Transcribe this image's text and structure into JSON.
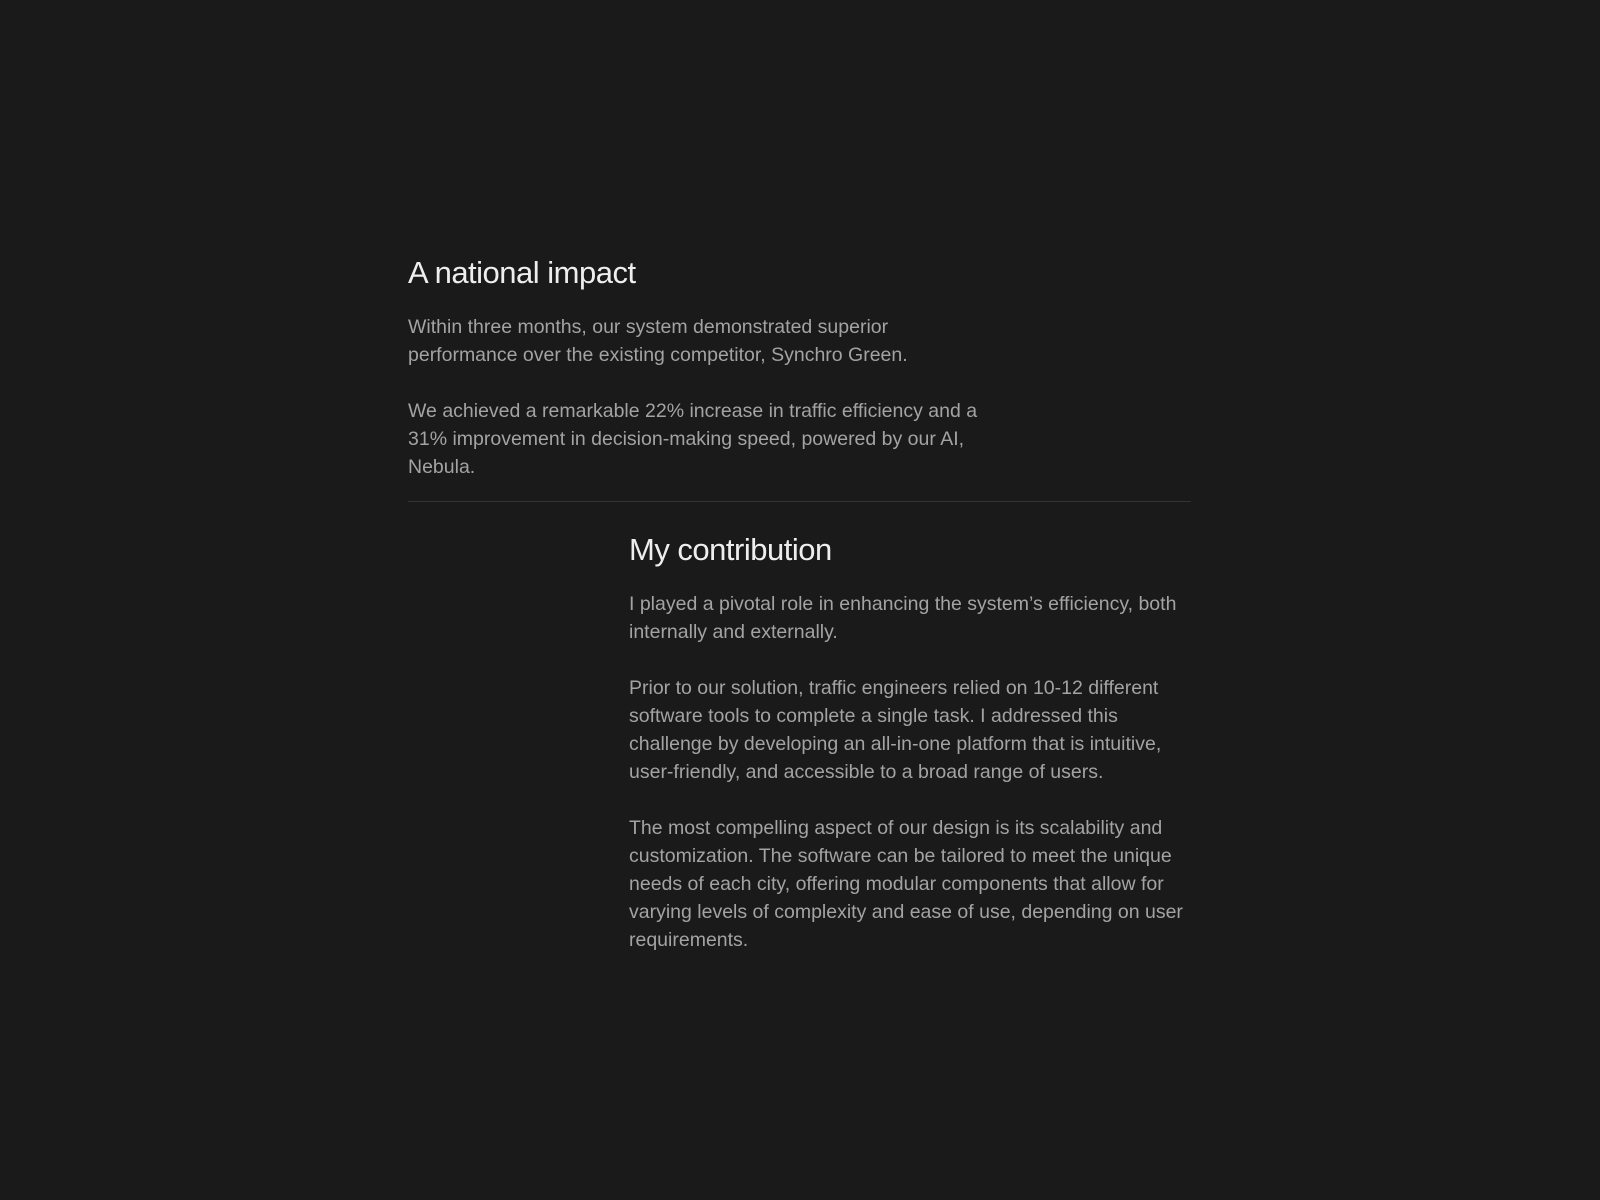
{
  "impact": {
    "heading": "A national impact",
    "paragraphs": [
      "Within three months, our system demonstrated superior performance over the existing competitor, Synchro Green.",
      "We achieved a remarkable 22% increase in traffic efficiency and a 31% improvement in decision-making speed, powered by our AI, Nebula."
    ]
  },
  "contribution": {
    "heading": "My contribution",
    "paragraphs": [
      "I played a pivotal role in enhancing the system’s efficiency, both internally and externally.",
      "Prior to our solution, traffic engineers relied on 10-12 different software tools to complete a single task. I addressed this challenge by developing an all-in-one platform that is intuitive, user-friendly, and accessible to a broad range of users.",
      "The most compelling aspect of our design is its scalability and customization. The software can be tailored to meet the unique needs of each city, offering modular components that allow for varying levels of complexity and ease of use, depending on user requirements."
    ]
  },
  "colors": {
    "background": "#1a1a1a",
    "heading": "#eeeeee",
    "body_text": "#a3a3a3",
    "divider": "#333333"
  }
}
